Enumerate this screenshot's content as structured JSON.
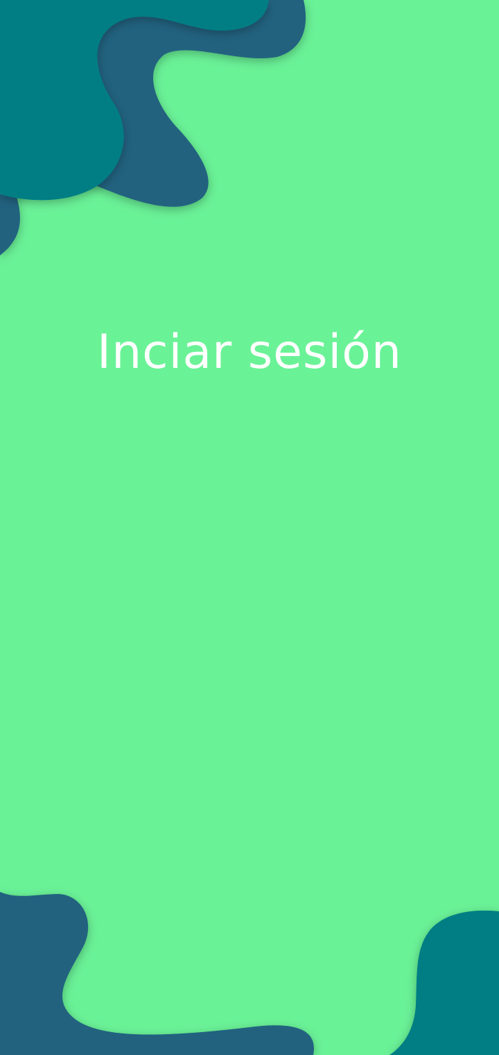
{
  "screen": {
    "title": "Inciar sesión"
  },
  "colors": {
    "background": "#6af297",
    "blob_dark_blue": "#22627f",
    "blob_teal": "#007e84"
  }
}
